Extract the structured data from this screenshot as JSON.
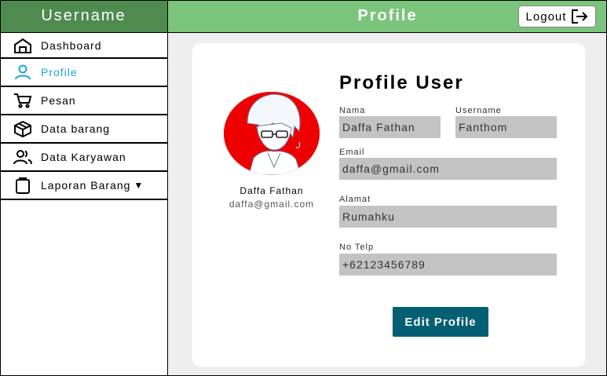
{
  "sidebar": {
    "header": "Username",
    "items": [
      {
        "label": "Dashboard",
        "icon": "home-icon"
      },
      {
        "label": "Profile",
        "icon": "user-icon"
      },
      {
        "label": "Pesan",
        "icon": "cart-icon"
      },
      {
        "label": "Data barang",
        "icon": "box-icon"
      },
      {
        "label": "Data Karyawan",
        "icon": "users-icon"
      },
      {
        "label": "Laporan Barang",
        "icon": "clipboard-icon"
      }
    ],
    "active_color": "#1aa3d9"
  },
  "topbar": {
    "title": "Profile",
    "logout_label": "Logout",
    "color": "#7bc47b"
  },
  "profile": {
    "name": "Daffa Fathan",
    "email": "daffa@gmail.com"
  },
  "form": {
    "title": "Profile User",
    "nama_label": "Nama",
    "nama_value": "Daffa Fathan",
    "username_label": "Username",
    "username_value": "Fanthom",
    "email_label": "Email",
    "email_value": "daffa@gmail.com",
    "alamat_label": "Alamat",
    "alamat_value": "Rumahku",
    "telp_label": "No Telp",
    "telp_value": "+62123456789",
    "edit_label": "Edit Profile",
    "button_color": "#045f73"
  }
}
